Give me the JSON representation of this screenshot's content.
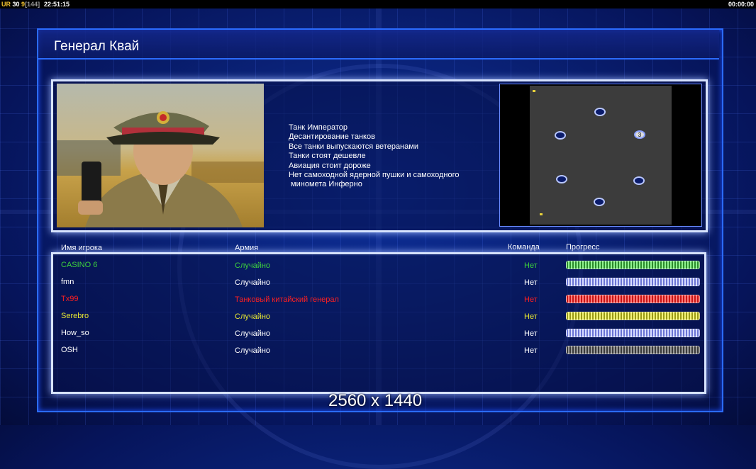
{
  "status_bar": {
    "ur_label": "UR",
    "ur_value_a": "30",
    "ur_value_b": "9",
    "ur_value_c": "[144]",
    "clock": "22:51:15",
    "game_timer": "00:00:00"
  },
  "general": {
    "title": "Генерал Квай",
    "features": [
      "Танк Император",
      "Десантирование танков",
      "Все танки выпускаются ветеранами",
      "Танки стоят дешевле",
      "Авиация стоит дороже",
      "Нет самоходной ядерной пушки и самоходного",
      " миномета Инферно"
    ]
  },
  "minimap": {
    "marked_spot_label": "3"
  },
  "players_table": {
    "headers": {
      "name": "Имя игрока",
      "army": "Армия",
      "team": "Команда",
      "progress": "Прогресс"
    },
    "rows": [
      {
        "name": "CASINO 6",
        "army": "Случайно",
        "team": "Нет",
        "color": "#3dd13d",
        "army_color": "#3dd13d",
        "progress": 1.0
      },
      {
        "name": "fmn",
        "army": "Случайно",
        "team": "Нет",
        "color": "#ffffff",
        "army_color": "#ffffff",
        "progress": 1.0
      },
      {
        "name": "Tx99",
        "army": "Танковый китайский генерал",
        "team": "Нет",
        "color": "#ff2020",
        "army_color": "#ff2020",
        "progress": 1.0
      },
      {
        "name": "Serebro",
        "army": "Случайно",
        "team": "Нет",
        "color": "#e8e832",
        "army_color": "#e8e832",
        "progress": 1.0
      },
      {
        "name": "How_so",
        "army": "Случайно",
        "team": "Нет",
        "color": "#ffffff",
        "army_color": "#ffffff",
        "progress": 1.0
      },
      {
        "name": "OSH",
        "army": "Случайно",
        "team": "Нет",
        "color": "#ffffff",
        "army_color": "#ffffff",
        "progress": 1.0
      }
    ]
  },
  "watermark": "2560 x 1440"
}
